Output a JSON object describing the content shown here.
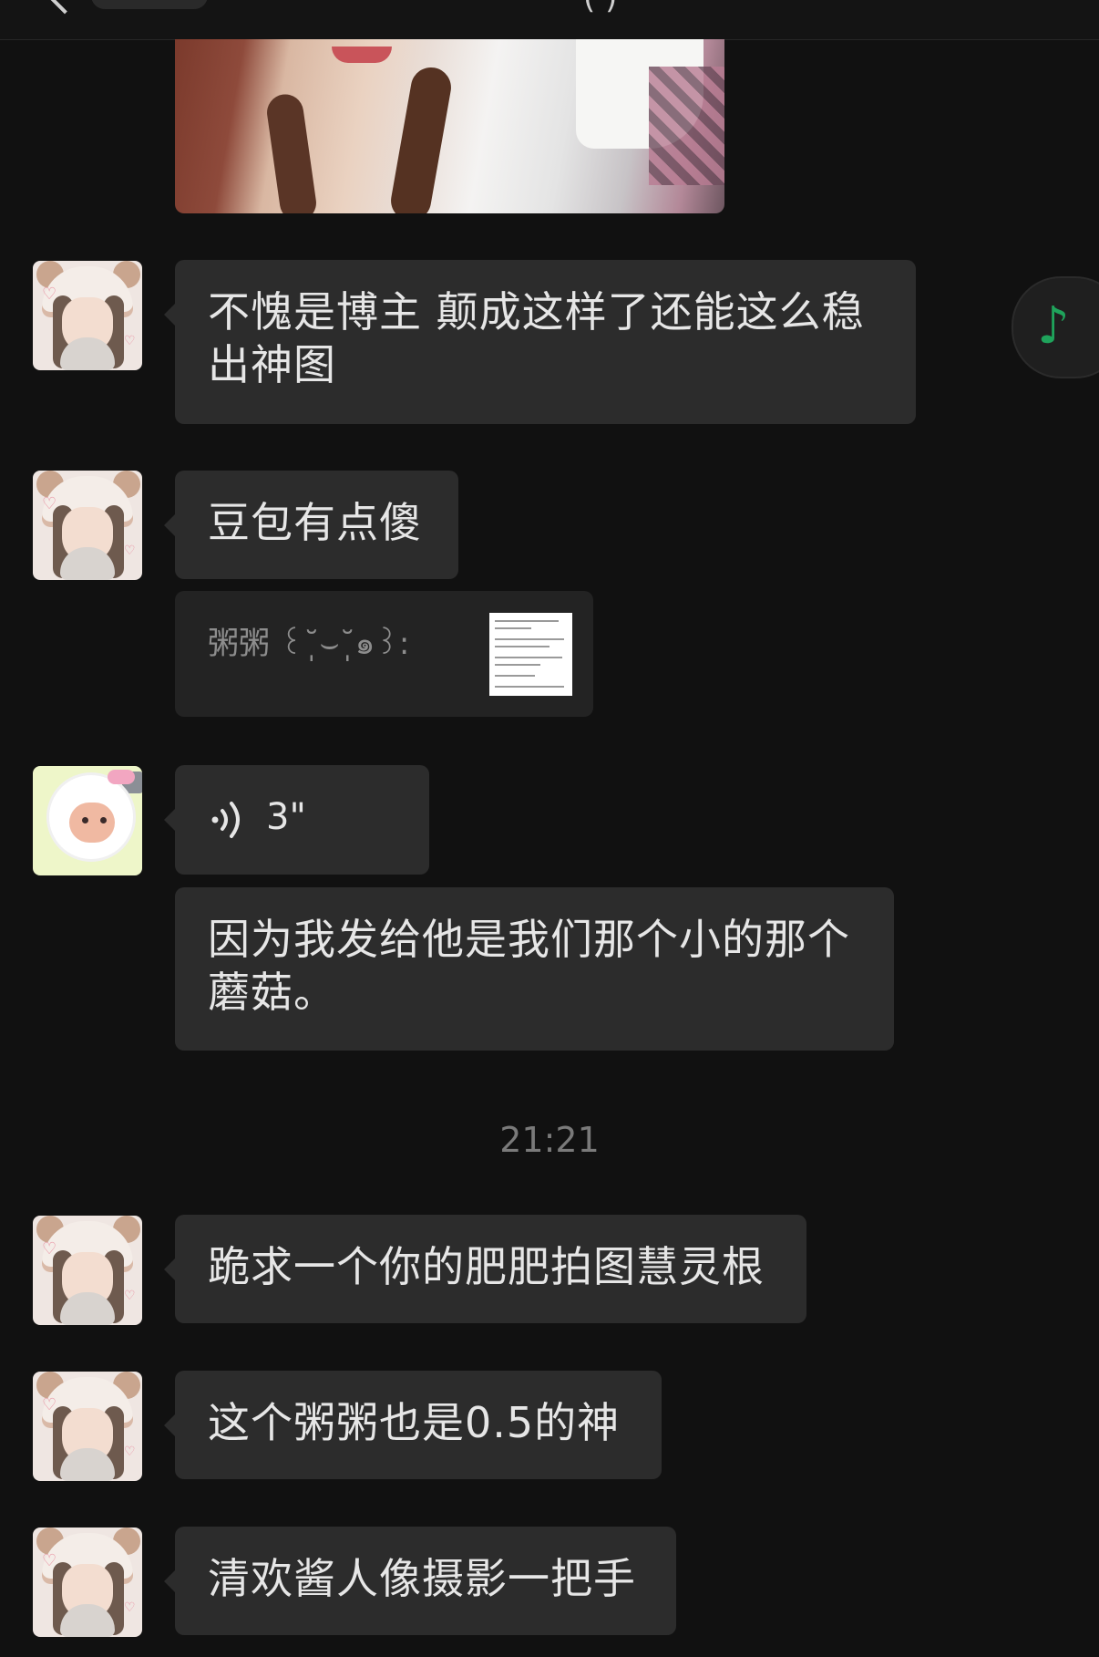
{
  "topbar": {
    "partial_title_glyph": "( )"
  },
  "messages": [
    {
      "id": "m1",
      "text": "不愧是博主  颠成这样了还能这么稳\n出神图"
    },
    {
      "id": "m2",
      "text": "豆包有点傻"
    },
    {
      "id": "m3",
      "quote_text": "粥粥 ꒰˘̩̩̩⌣˘̩̩̩๑꒱:"
    },
    {
      "id": "m4",
      "voice_duration": "3\""
    },
    {
      "id": "m5",
      "text": "因为我发给他是我们那个小的那个\n蘑菇。"
    },
    {
      "id": "m6",
      "text": "跪求一个你的肥肥拍图慧灵根"
    },
    {
      "id": "m7",
      "text": "这个粥粥也是0.5的神"
    },
    {
      "id": "m8",
      "text": "清欢酱人像摄影一把手"
    }
  ],
  "timestamp": "21:21",
  "colors": {
    "background": "#111111",
    "bubble": "#2c2c2c",
    "quote_bg": "#232323",
    "accent_green": "#1fa35b",
    "timestamp": "#7a7a7a"
  },
  "icons": {
    "voice": "voice-wave-icon",
    "music": "music-note-icon"
  }
}
